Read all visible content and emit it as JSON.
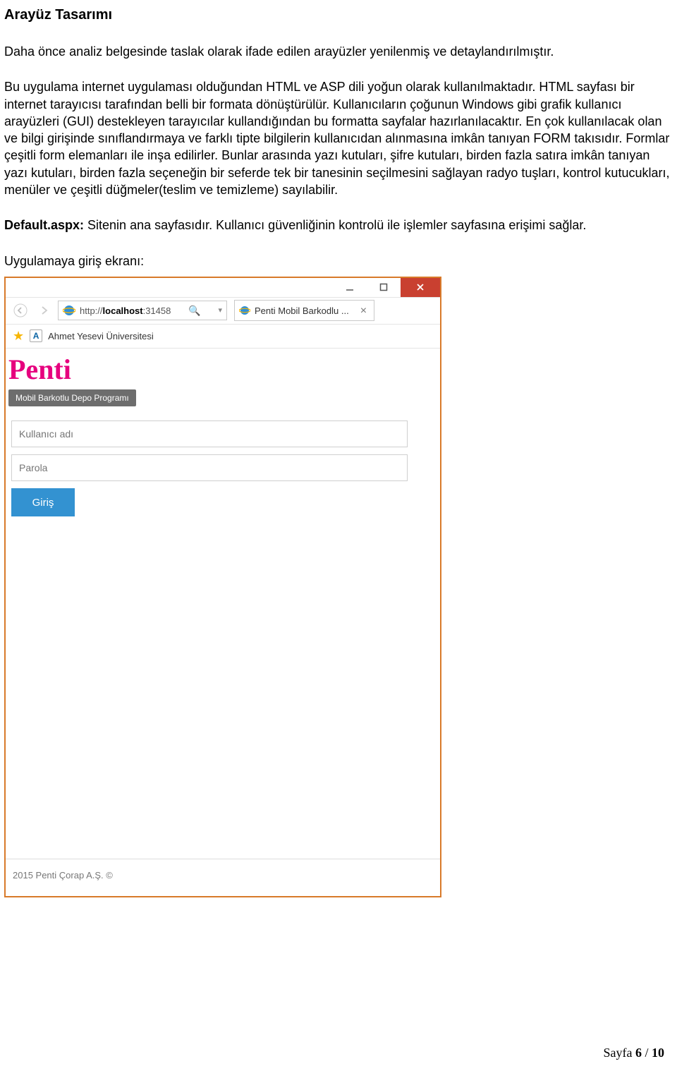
{
  "doc": {
    "heading": "Arayüz Tasarımı",
    "para1": "Daha önce analiz belgesinde taslak olarak ifade edilen arayüzler yenilenmiş ve detaylandırılmıştır.",
    "para2": "Bu uygulama internet uygulaması olduğundan HTML ve ASP dili yoğun olarak kullanılmaktadır. HTML sayfası bir internet tarayıcısı tarafından belli bir formata dönüştürülür. Kullanıcıların çoğunun Windows gibi grafik kullanıcı arayüzleri (GUI) destekleyen tarayıcılar kullandığından bu formatta sayfalar hazırlanılacaktır. En çok kullanılacak olan ve bilgi girişinde sınıflandırmaya ve farklı tipte bilgilerin kullanıcıdan alınmasına imkân tanıyan FORM takısıdır. Formlar çeşitli form elemanları ile inşa edilirler. Bunlar arasında yazı kutuları, şifre kutuları, birden fazla satıra imkân tanıyan yazı kutuları, birden fazla seçeneğin bir seferde tek bir tanesinin seçilmesini sağlayan radyo tuşları, kontrol kutucukları, menüler ve çeşitli düğmeler(teslim ve temizleme) sayılabilir.",
    "default_label": "Default.aspx: ",
    "default_text": "Sitenin ana sayfasıdır. Kullanıcı güvenliğinin kontrolü ile işlemler sayfasına erişimi sağlar.",
    "login_caption": "Uygulamaya giriş ekranı:"
  },
  "browser": {
    "url_prefix": "http://",
    "url_host": "localhost",
    "url_suffix": ":31458",
    "tab_title": "Penti Mobil Barkodlu ...",
    "favorite_label": "Ahmet Yesevi Üniversitesi"
  },
  "login_page": {
    "brand": "Penti",
    "subtitle": "Mobil Barkotlu Depo Programı",
    "username_placeholder": "Kullanıcı adı",
    "password_placeholder": "Parola",
    "login_button": "Giriş",
    "footer": "2015 Penti Çorap A.Ş. ©"
  },
  "footer": {
    "page_label": "Sayfa ",
    "page_current": "6",
    "page_sep": " / ",
    "page_total": "10"
  }
}
